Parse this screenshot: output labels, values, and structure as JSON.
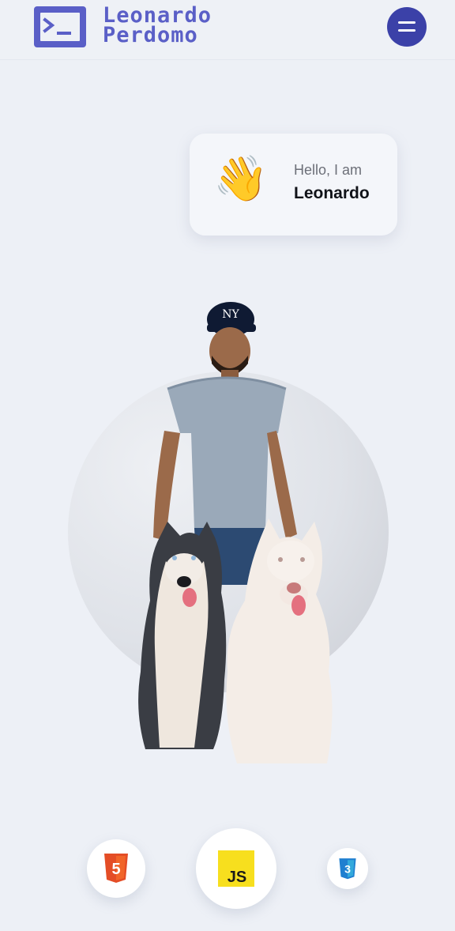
{
  "header": {
    "logo_line1": "Leonardo",
    "logo_line2": "Perdomo",
    "logo_icon": "terminal-icon",
    "menu_icon": "hamburger-icon",
    "accent": "#5a5fc7",
    "menu_color": "#3b41a8"
  },
  "hero": {
    "greeting": "Hello, I am",
    "name": "Leonardo",
    "wave_emoji": "👋",
    "photo_alt": "Leonardo with two husky dogs"
  },
  "tech_badges": [
    {
      "icon": "html5-icon",
      "label": "5",
      "color": "#e44d26"
    },
    {
      "icon": "javascript-icon",
      "label": "JS",
      "color": "#f7df1e"
    },
    {
      "icon": "css3-icon",
      "label": "3",
      "color": "#1f7fd0"
    }
  ]
}
